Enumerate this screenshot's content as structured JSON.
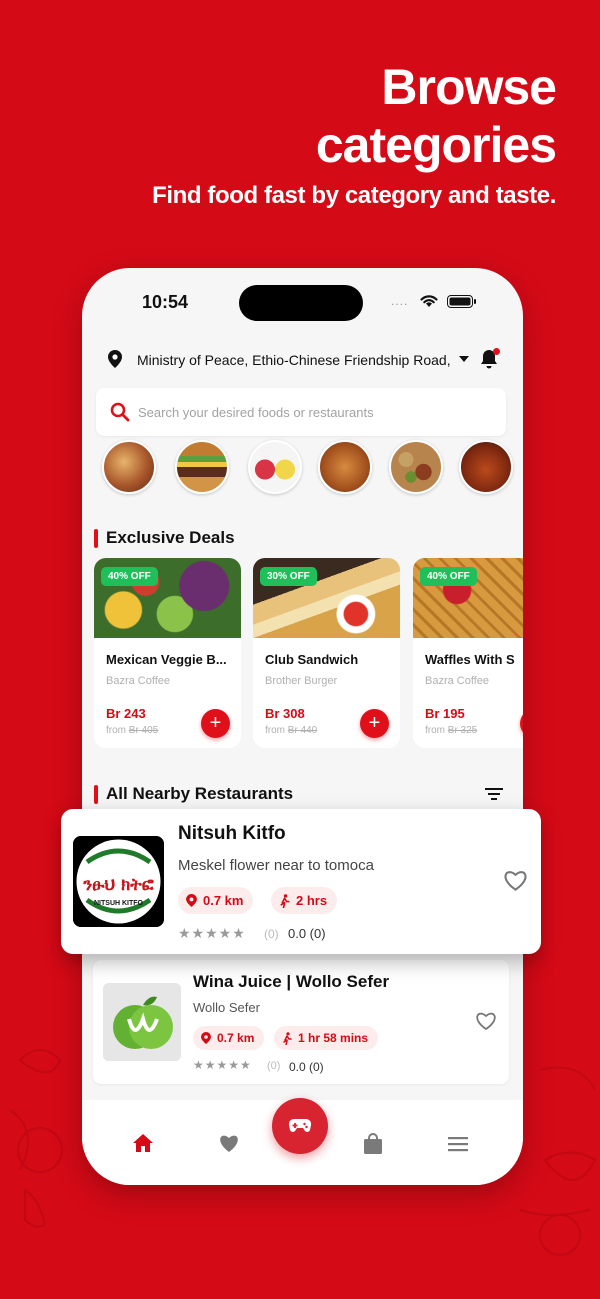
{
  "hero": {
    "title_line1": "Browse",
    "title_line2": "categories",
    "subtitle": "Find food fast by category and taste."
  },
  "status_bar": {
    "time": "10:54",
    "dots": "...."
  },
  "location": {
    "address": "Ministry of Peace, Ethio-Chinese Friendship Road, ..."
  },
  "search": {
    "placeholder": "Search your desired foods or restaurants"
  },
  "categories": [
    "pizza",
    "burger",
    "juice",
    "chicken",
    "platter",
    "wings"
  ],
  "exclusive_deals": {
    "title": "Exclusive Deals",
    "items": [
      {
        "badge": "40% OFF",
        "name": "Mexican Veggie B...",
        "shop": "Bazra Coffee",
        "price": "Br 243",
        "from": "from",
        "old_price": "Br 405",
        "add": "+"
      },
      {
        "badge": "30% OFF",
        "name": "Club Sandwich",
        "shop": "Brother Burger",
        "price": "Br 308",
        "from": "from",
        "old_price": "Br 440",
        "add": "+"
      },
      {
        "badge": "40% OFF",
        "name": "Waffles With S",
        "shop": "Bazra Coffee",
        "price": "Br 195",
        "from": "from",
        "old_price": "Br 325",
        "add": "+"
      }
    ]
  },
  "nearby": {
    "title": "All Nearby Restaurants",
    "restaurants": [
      {
        "name": "Nitsuh Kitfo",
        "subtitle": "Meskel flower near to tomoca",
        "distance": "0.7 km",
        "time": "2 hrs",
        "stars": "★★★★★",
        "rating_count": "(0)",
        "score": "0.0 (0)",
        "logo_text_amharic": "ንፁህ ክትፎ",
        "logo_text": "NITSUH KITFO"
      },
      {
        "name": "Wina Juice |  Wollo Sefer",
        "subtitle": "Wollo Sefer",
        "distance": "0.7 km",
        "time": "1 hr 58 mins",
        "stars": "★★★★★",
        "rating_count": "(0)",
        "score": "0.0 (0)"
      }
    ]
  },
  "nav": [
    "home-icon",
    "heart-icon",
    "gamepad-icon",
    "bag-icon",
    "menu-icon"
  ],
  "colors": {
    "brand": "#d50a17",
    "badge": "#1fbf5a",
    "chip_bg": "#fdecec"
  }
}
